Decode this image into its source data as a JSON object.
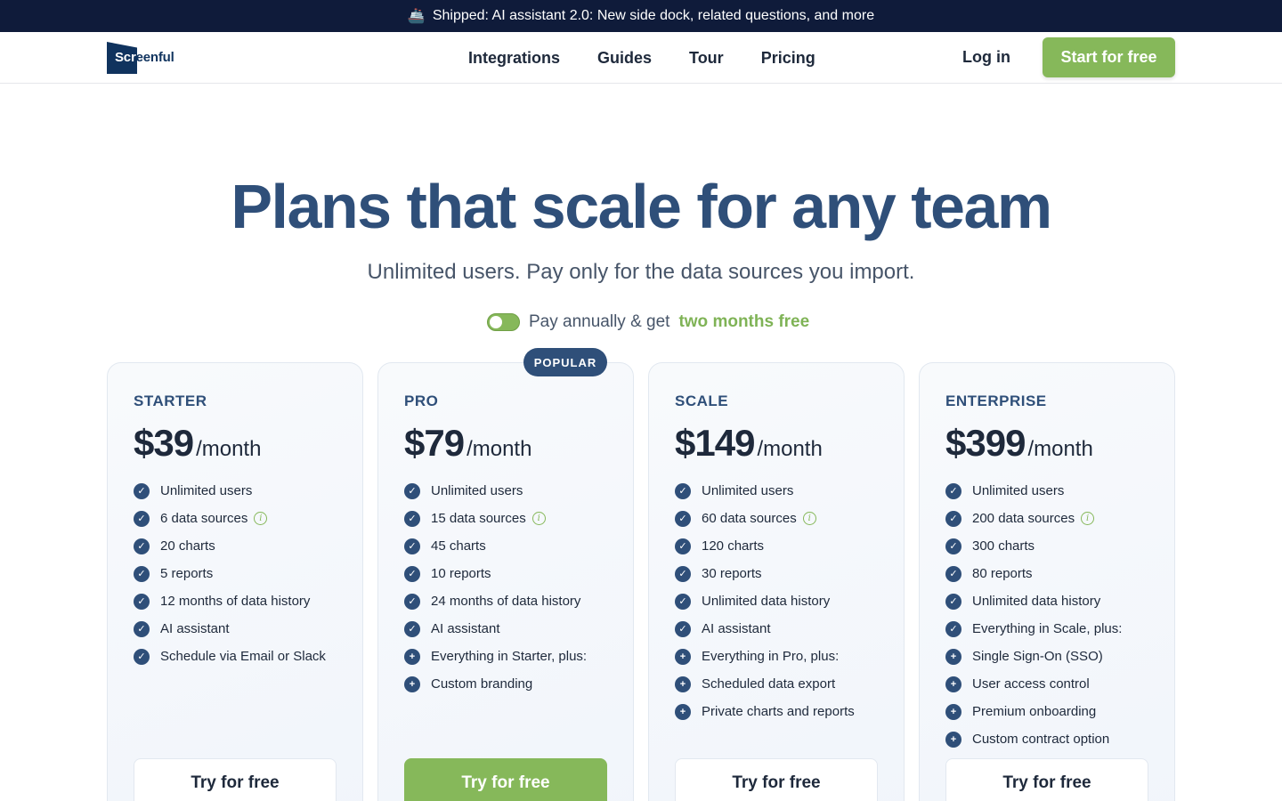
{
  "announcement": {
    "icon": "ship-icon",
    "text": "Shipped: AI assistant 2.0: New side dock, related questions, and more"
  },
  "brand": {
    "name_part1": "Scr",
    "name_part2": "eenful"
  },
  "nav": {
    "links": [
      "Integrations",
      "Guides",
      "Tour",
      "Pricing"
    ],
    "login": "Log in",
    "cta": "Start for free"
  },
  "hero": {
    "title": "Plans that scale for any team",
    "subtitle": "Unlimited users. Pay only for the data sources you import.",
    "toggle_text": "Pay annually & get",
    "toggle_highlight": "two months free"
  },
  "plans": [
    {
      "name": "STARTER",
      "price": "$39",
      "period": "/month",
      "features": [
        {
          "text": "Unlimited users",
          "icon": "check"
        },
        {
          "text": "6 data sources",
          "icon": "check",
          "info": true
        },
        {
          "text": "20 charts",
          "icon": "check"
        },
        {
          "text": "5 reports",
          "icon": "check"
        },
        {
          "text": "12 months of data history",
          "icon": "check"
        },
        {
          "text": "AI assistant",
          "icon": "check"
        },
        {
          "text": "Schedule via Email or Slack",
          "icon": "check"
        }
      ],
      "button": "Try for free",
      "primary": false
    },
    {
      "name": "PRO",
      "price": "$79",
      "period": "/month",
      "badge": "POPULAR",
      "features": [
        {
          "text": "Unlimited users",
          "icon": "check"
        },
        {
          "text": "15 data sources",
          "icon": "check",
          "info": true
        },
        {
          "text": "45 charts",
          "icon": "check"
        },
        {
          "text": "10 reports",
          "icon": "check"
        },
        {
          "text": "24 months of data history",
          "icon": "check"
        },
        {
          "text": "AI assistant",
          "icon": "check"
        },
        {
          "text": "Everything in Starter, plus:",
          "icon": "plus"
        },
        {
          "text": "Custom branding",
          "icon": "plus"
        }
      ],
      "button": "Try for free",
      "primary": true
    },
    {
      "name": "SCALE",
      "price": "$149",
      "period": "/month",
      "features": [
        {
          "text": "Unlimited users",
          "icon": "check"
        },
        {
          "text": "60 data sources",
          "icon": "check",
          "info": true
        },
        {
          "text": "120 charts",
          "icon": "check"
        },
        {
          "text": "30 reports",
          "icon": "check"
        },
        {
          "text": "Unlimited data history",
          "icon": "check"
        },
        {
          "text": "AI assistant",
          "icon": "check"
        },
        {
          "text": "Everything in Pro, plus:",
          "icon": "plus"
        },
        {
          "text": "Scheduled data export",
          "icon": "plus"
        },
        {
          "text": "Private charts and reports",
          "icon": "plus"
        }
      ],
      "button": "Try for free",
      "primary": false
    },
    {
      "name": "ENTERPRISE",
      "price": "$399",
      "period": "/month",
      "features": [
        {
          "text": "Unlimited users",
          "icon": "check"
        },
        {
          "text": "200 data sources",
          "icon": "check",
          "info": true
        },
        {
          "text": "300 charts",
          "icon": "check"
        },
        {
          "text": "80 reports",
          "icon": "check"
        },
        {
          "text": "Unlimited data history",
          "icon": "check"
        },
        {
          "text": "Everything in Scale, plus:",
          "icon": "check"
        },
        {
          "text": "Single Sign-On (SSO)",
          "icon": "plus"
        },
        {
          "text": "User access control",
          "icon": "plus"
        },
        {
          "text": "Premium onboarding",
          "icon": "plus"
        },
        {
          "text": "Custom contract option",
          "icon": "plus"
        }
      ],
      "button": "Try for free",
      "primary": false
    }
  ],
  "colors": {
    "accent_green": "#86b85a",
    "navy": "#2f4f79",
    "banner": "#0f1b3a"
  }
}
